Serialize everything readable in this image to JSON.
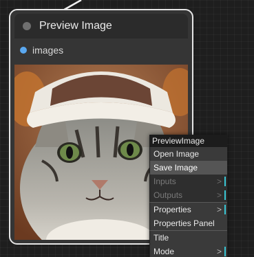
{
  "node": {
    "title": "Preview Image",
    "input_label": "images"
  },
  "context_menu": {
    "title": "PreviewImage",
    "items": [
      {
        "label": "Open Image",
        "arrow": ""
      },
      {
        "label": "Save Image",
        "arrow": ""
      },
      {
        "label": "Inputs",
        "arrow": ">"
      },
      {
        "label": "Outputs",
        "arrow": ">"
      },
      {
        "label": "Properties",
        "arrow": ">"
      },
      {
        "label": "Properties Panel",
        "arrow": ""
      },
      {
        "label": "Title",
        "arrow": ""
      },
      {
        "label": "Mode",
        "arrow": ">"
      }
    ]
  },
  "colors": {
    "node_border": "#e6e6e6",
    "input_dot": "#5aa8f0",
    "accent": "#39c6d4"
  }
}
